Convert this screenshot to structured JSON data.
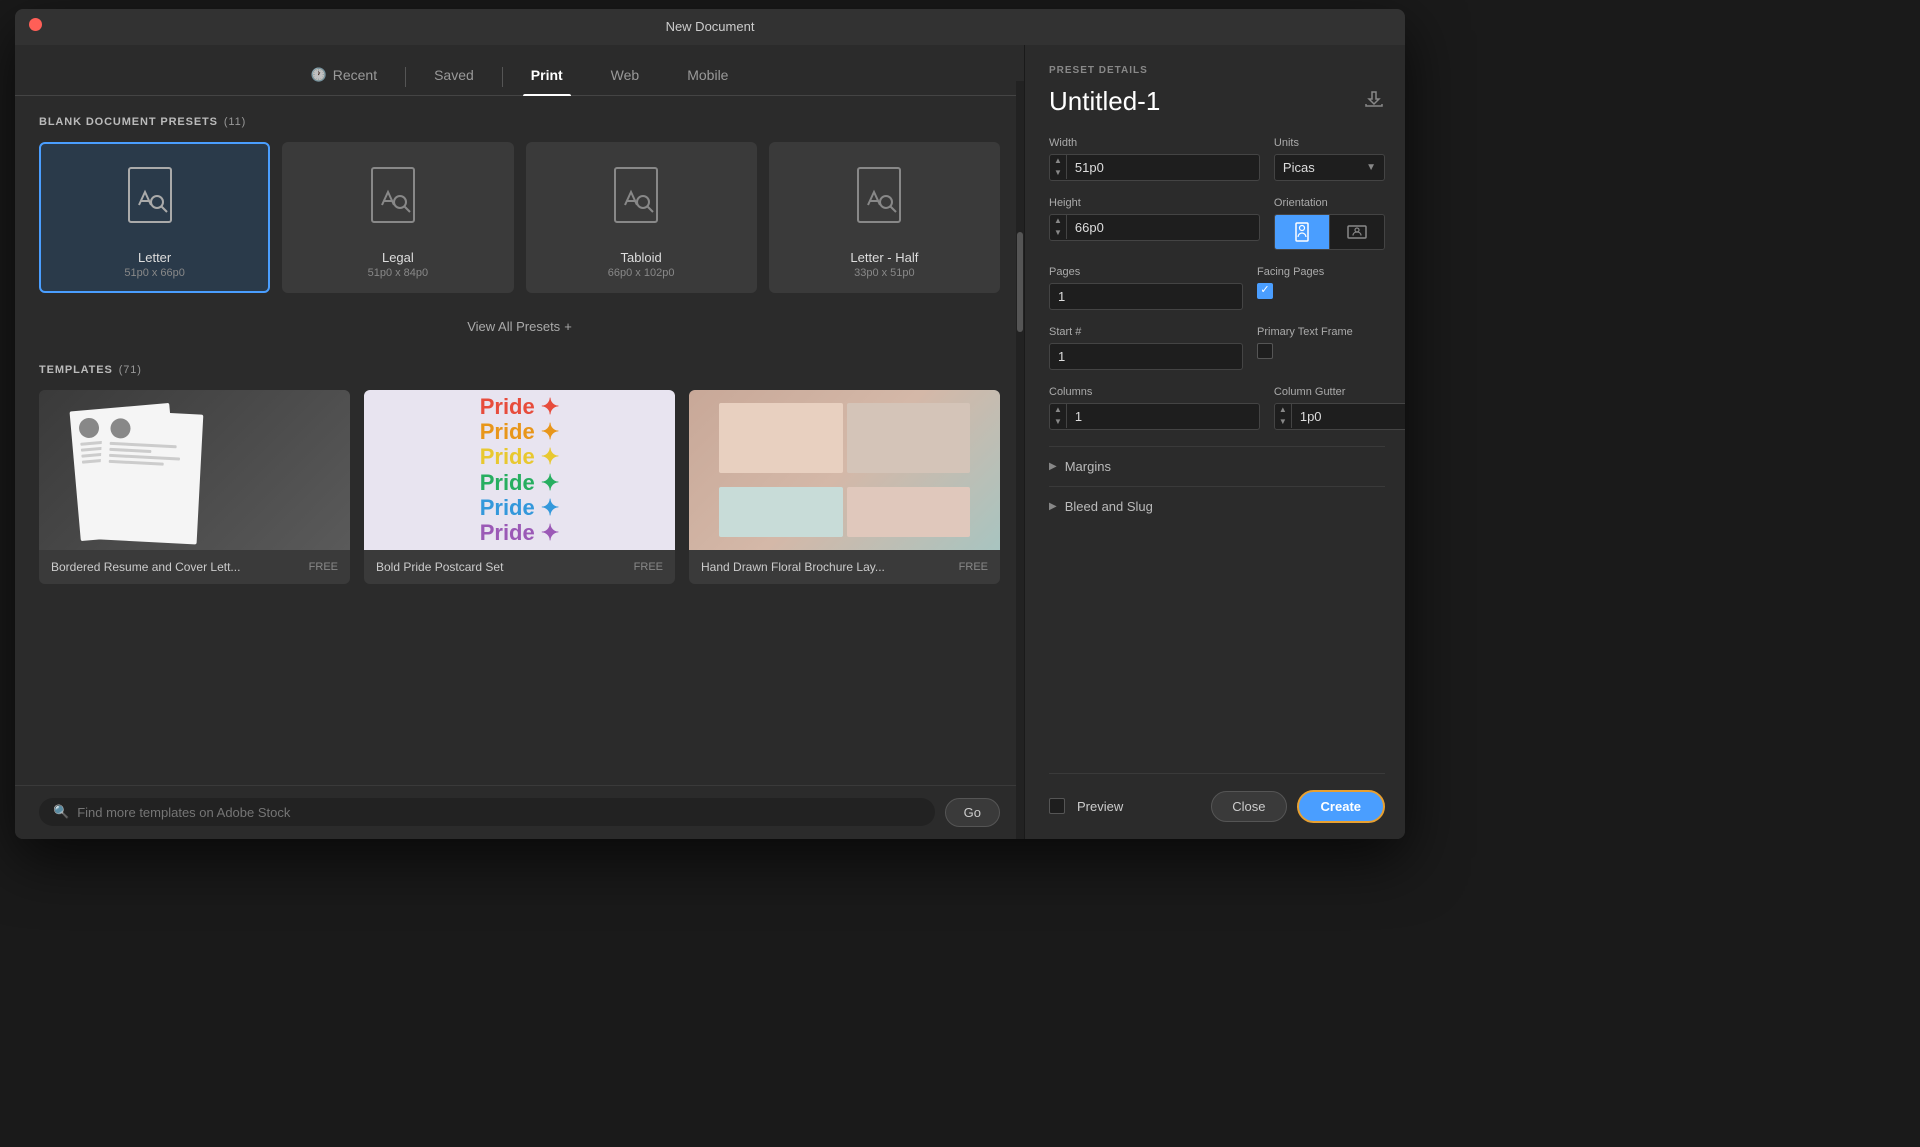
{
  "window": {
    "title": "New Document"
  },
  "tabs": [
    {
      "id": "recent",
      "label": "Recent",
      "icon": "clock",
      "active": false
    },
    {
      "id": "saved",
      "label": "Saved",
      "active": false
    },
    {
      "id": "print",
      "label": "Print",
      "active": true
    },
    {
      "id": "web",
      "label": "Web",
      "active": false
    },
    {
      "id": "mobile",
      "label": "Mobile",
      "active": false
    }
  ],
  "presets_section": {
    "label": "BLANK DOCUMENT PRESETS",
    "count": "(11)",
    "presets": [
      {
        "name": "Letter",
        "size": "51p0 x 66p0",
        "selected": true
      },
      {
        "name": "Legal",
        "size": "51p0 x 84p0",
        "selected": false
      },
      {
        "name": "Tabloid",
        "size": "66p0 x 102p0",
        "selected": false
      },
      {
        "name": "Letter - Half",
        "size": "33p0 x 51p0",
        "selected": false
      }
    ],
    "view_all_label": "View All Presets",
    "view_all_plus": "+"
  },
  "templates_section": {
    "label": "TEMPLATES",
    "count": "(71)",
    "templates": [
      {
        "name": "Bordered Resume and Cover Lett...",
        "badge": "FREE"
      },
      {
        "name": "Bold Pride Postcard Set",
        "badge": "FREE"
      },
      {
        "name": "Hand Drawn Floral Brochure Lay...",
        "badge": "FREE"
      }
    ]
  },
  "search": {
    "placeholder": "Find more templates on Adobe Stock",
    "go_label": "Go"
  },
  "preset_details": {
    "section_label": "PRESET DETAILS",
    "doc_name": "Untitled-1",
    "width_label": "Width",
    "width_value": "51p0",
    "units_label": "Units",
    "units_value": "Picas",
    "height_label": "Height",
    "height_value": "66p0",
    "orientation_label": "Orientation",
    "pages_label": "Pages",
    "pages_value": "1",
    "facing_pages_label": "Facing Pages",
    "start_label": "Start #",
    "start_value": "1",
    "primary_text_frame_label": "Primary Text Frame",
    "columns_label": "Columns",
    "columns_value": "1",
    "column_gutter_label": "Column Gutter",
    "column_gutter_value": "1p0",
    "margins_label": "Margins",
    "bleed_slug_label": "Bleed and Slug",
    "preview_label": "Preview",
    "close_label": "Close",
    "create_label": "Create"
  },
  "pride_colors": [
    "#e74c3c",
    "#e8a030",
    "#f1c40f",
    "#27ae60",
    "#3498db",
    "#9b59b6"
  ]
}
